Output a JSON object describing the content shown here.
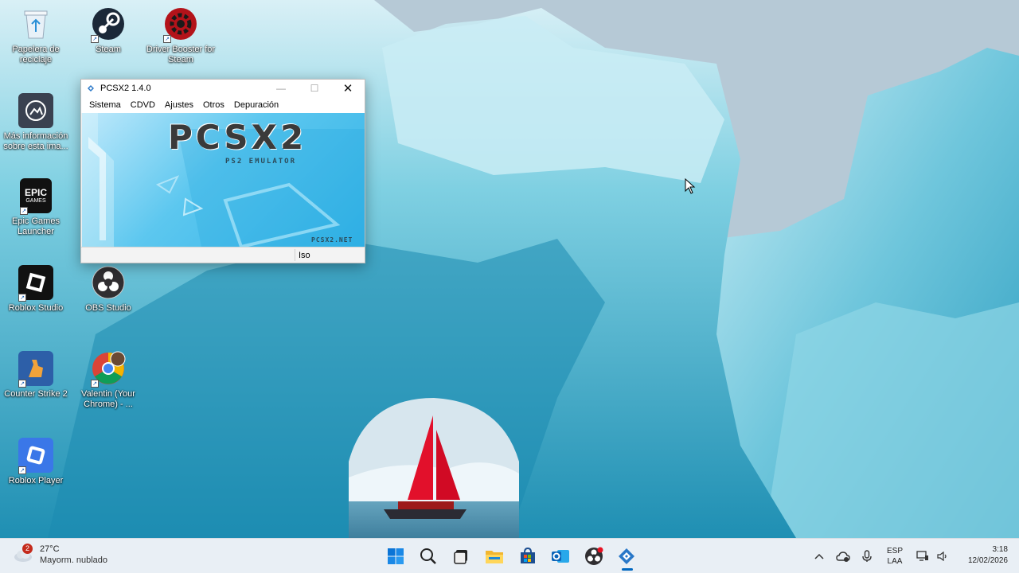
{
  "desktop": {
    "icons": [
      {
        "label": "Papelera de reciclaje",
        "icon": "recycle-bin-icon"
      },
      {
        "label": "Steam",
        "icon": "steam-icon"
      },
      {
        "label": "Driver Booster for Steam",
        "icon": "driver-booster-icon"
      },
      {
        "label": "Más información sobre esta ima...",
        "icon": "spotlight-info-icon"
      },
      {
        "label": "Epic Games Launcher",
        "icon": "epic-games-icon"
      },
      {
        "label": "Roblox Studio",
        "icon": "roblox-studio-icon"
      },
      {
        "label": "OBS Studio",
        "icon": "obs-studio-icon"
      },
      {
        "label": "Counter Strike 2",
        "icon": "counter-strike-icon"
      },
      {
        "label": "Valentin (Your Chrome) - ...",
        "icon": "chrome-profile-icon"
      },
      {
        "label": "Roblox Player",
        "icon": "roblox-player-icon"
      }
    ],
    "epic_logo_text_top": "EPIC",
    "epic_logo_text_bottom": "GAMES"
  },
  "window": {
    "title": "PCSX2  1.4.0",
    "menu": [
      "Sistema",
      "CDVD",
      "Ajustes",
      "Otros",
      "Depuración"
    ],
    "banner_logo": "PCSX2",
    "banner_subtitle": "PS2 EMULATOR",
    "banner_url": "PCSX2.NET",
    "status_iso": "Iso"
  },
  "taskbar": {
    "weather_badge": "2",
    "weather_temp": "27°C",
    "weather_condition": "Mayorm. nublado",
    "apps": [
      "windows-start-icon",
      "search-icon",
      "task-view-icon",
      "file-explorer-icon",
      "microsoft-store-icon",
      "outlook-icon",
      "obs-taskbar-icon",
      "pcsx2-taskbar-icon"
    ],
    "tray_lang_1": "ESP",
    "tray_lang_2": "LAA",
    "time": "3:18",
    "date": "12/02/2026"
  },
  "colors": {
    "taskbar_bg": "#e9eff5",
    "accent": "#0067c0",
    "banner_blue": "#33b3e7",
    "sail_red": "#e2102b"
  }
}
